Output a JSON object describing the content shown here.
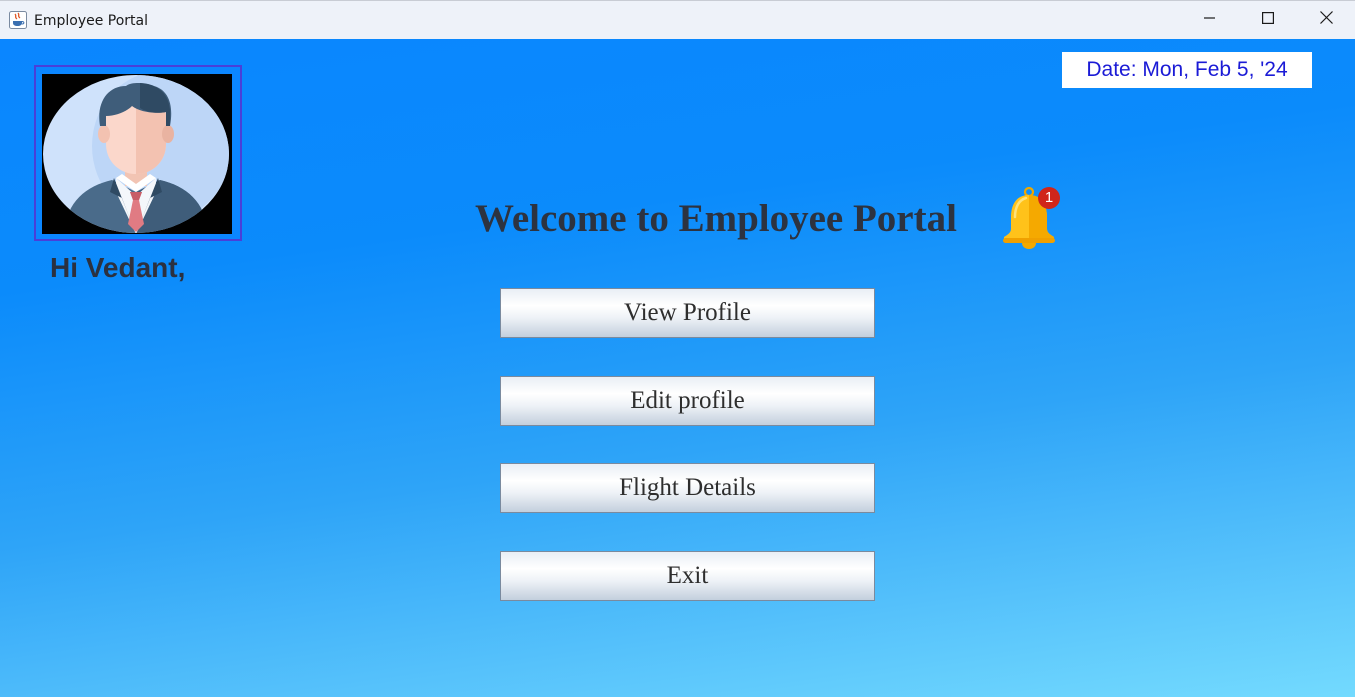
{
  "window": {
    "title": "Employee Portal",
    "controls": {
      "minimize_icon": "minimize-icon",
      "maximize_icon": "maximize-icon",
      "close_icon": "close-icon"
    }
  },
  "header": {
    "date_text": "Date: Mon, Feb 5, '24"
  },
  "profile": {
    "greeting": "Hi Vedant,",
    "avatar_icon": "businessman-avatar-icon"
  },
  "main": {
    "welcome_title": "Welcome to Employee Portal",
    "notifications": {
      "icon": "bell-icon",
      "count": "1"
    },
    "menu": [
      {
        "label": "View Profile"
      },
      {
        "label": "Edit profile"
      },
      {
        "label": "Flight Details"
      },
      {
        "label": "Exit"
      }
    ]
  },
  "colors": {
    "background_top": "#0a86ff",
    "background_bottom": "#73dafe",
    "date_text": "#1b1bd6",
    "heading_text": "#2d3340",
    "avatar_border": "#4a3fd8",
    "badge": "#d0261a",
    "bell": "#ffc21a"
  }
}
